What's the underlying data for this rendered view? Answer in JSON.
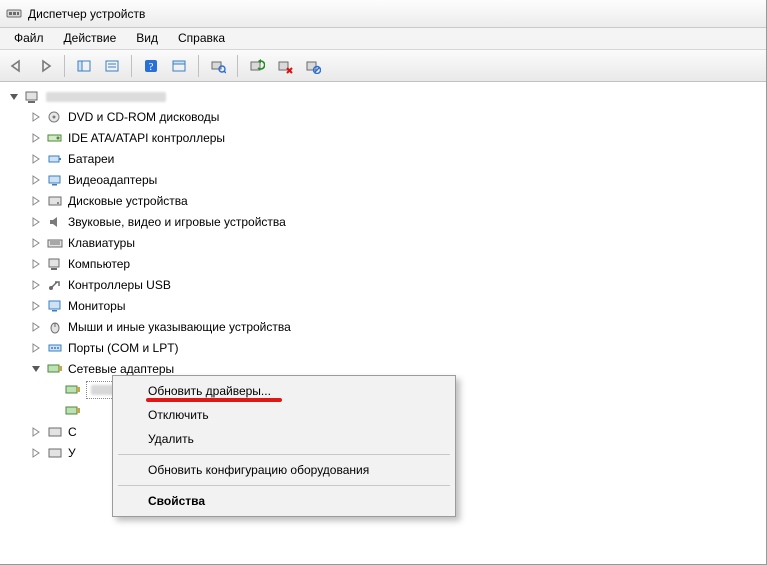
{
  "window": {
    "title": "Диспетчер устройств"
  },
  "menu": {
    "file": "Файл",
    "action": "Действие",
    "view": "Вид",
    "help": "Справка"
  },
  "tree": {
    "root_expanded": true,
    "items": [
      {
        "label": "DVD и CD-ROM дисководы",
        "icon": "disc"
      },
      {
        "label": "IDE ATA/ATAPI контроллеры",
        "icon": "ide"
      },
      {
        "label": "Батареи",
        "icon": "battery"
      },
      {
        "label": "Видеоадаптеры",
        "icon": "display"
      },
      {
        "label": "Дисковые устройства",
        "icon": "disk"
      },
      {
        "label": "Звуковые, видео и игровые устройства",
        "icon": "sound"
      },
      {
        "label": "Клавиатуры",
        "icon": "keyboard"
      },
      {
        "label": "Компьютер",
        "icon": "computer"
      },
      {
        "label": "Контроллеры USB",
        "icon": "usb"
      },
      {
        "label": "Мониторы",
        "icon": "monitor"
      },
      {
        "label": "Мыши и иные указывающие устройства",
        "icon": "mouse"
      },
      {
        "label": "Порты (COM и LPT)",
        "icon": "port"
      },
      {
        "label": "Сетевые адаптеры",
        "icon": "network",
        "expanded": true
      }
    ]
  },
  "context_menu": {
    "update_drivers": "Обновить драйверы...",
    "disable": "Отключить",
    "delete": "Удалить",
    "scan_hw": "Обновить конфигурацию оборудования",
    "properties": "Свойства"
  }
}
